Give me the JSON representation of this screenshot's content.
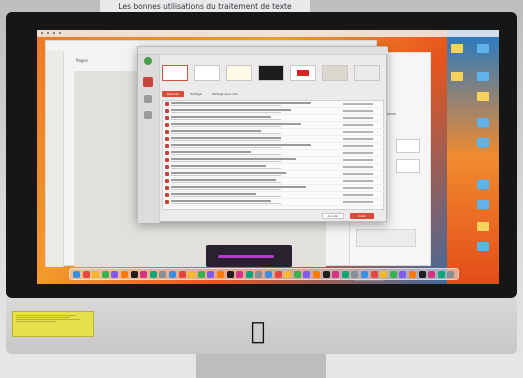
{
  "top_sign": {
    "text": "Les bonnes utilisations du traitement de texte"
  },
  "document_window": {
    "title": "Pages"
  },
  "dialog": {
    "title": "Choisir un modèle",
    "tabs": [
      "Récents",
      "Partagé",
      "Partagé avec moi"
    ],
    "cancel_label": "Annuler",
    "create_label": "Créer"
  },
  "dock": {
    "icon_count": 40
  },
  "colors": {
    "wallpaper_orange": "#f07a25",
    "wallpaper_blue": "#1d6fb8",
    "accent_red": "#d94c3a",
    "sticky_note": "#e6e04a"
  }
}
